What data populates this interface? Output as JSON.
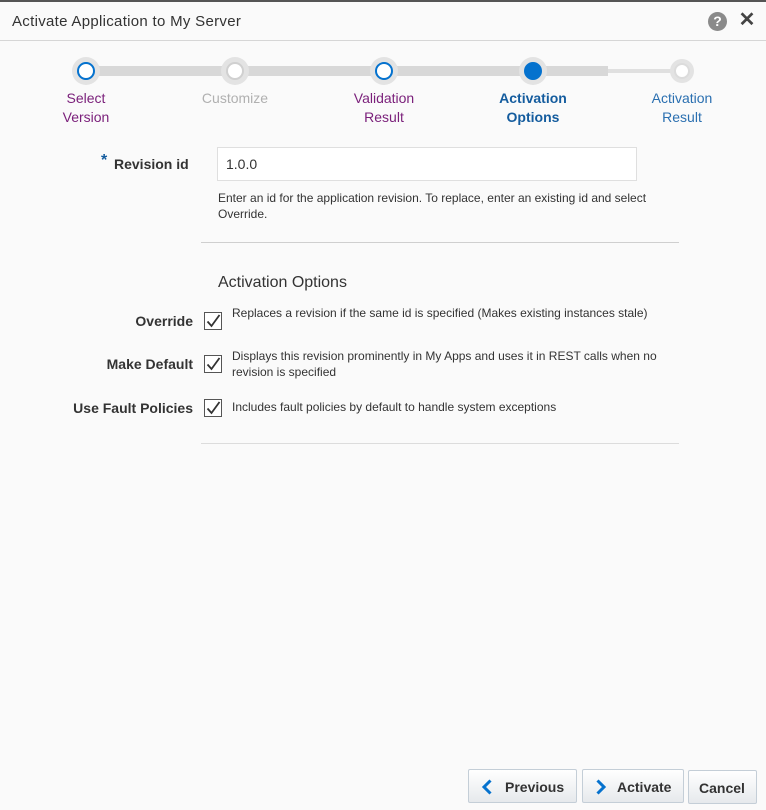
{
  "dialog": {
    "title": "Activate Application to My Server"
  },
  "train": {
    "stops": [
      {
        "line1": "Select",
        "line2": "Version",
        "state": "visited"
      },
      {
        "line1": "Customize",
        "line2": "",
        "state": "disabled"
      },
      {
        "line1": "Validation",
        "line2": "Result",
        "state": "visited"
      },
      {
        "line1": "Activation",
        "line2": "Options",
        "state": "current"
      },
      {
        "line1": "Activation",
        "line2": "Result",
        "state": "unvisited"
      }
    ]
  },
  "form": {
    "required_mark": "*",
    "revision_label": "Revision id",
    "revision_value": "1.0.0",
    "revision_help": "Enter an id for the application revision. To replace, enter an existing id and select Override.",
    "section_title": "Activation Options",
    "options": [
      {
        "label": "Override",
        "checked": true,
        "description": "Replaces a revision if the same id is specified (Makes existing instances stale)"
      },
      {
        "label": "Make Default",
        "checked": true,
        "description": "Displays this revision prominently in My Apps and uses it in REST calls when no revision is specified"
      },
      {
        "label": "Use Fault Policies",
        "checked": true,
        "description": "Includes fault policies by default to handle system exceptions"
      }
    ]
  },
  "buttons": {
    "previous": "Previous",
    "activate": "Activate",
    "cancel": "Cancel"
  },
  "colors": {
    "accent": "#0572ce",
    "visited_label": "#7a1f7a",
    "current_label": "#145c9e"
  }
}
